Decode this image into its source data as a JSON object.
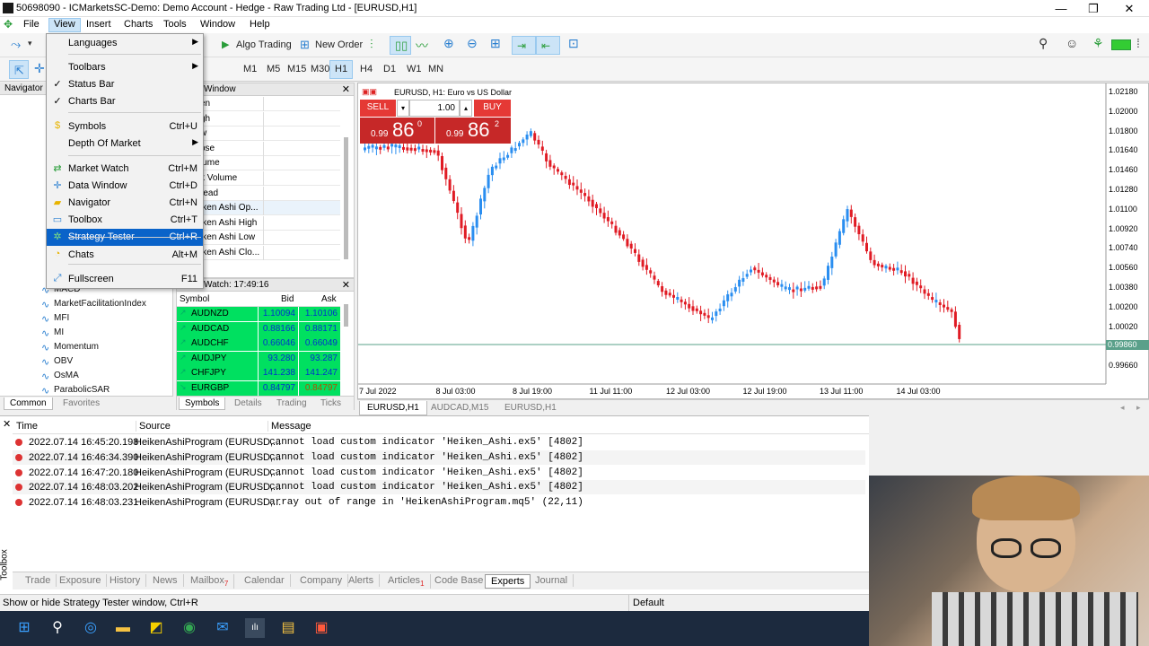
{
  "window": {
    "title": "50698090 - ICMarketsSC-Demo: Demo Account - Hedge - Raw Trading Ltd - [EURUSD,H1]",
    "min": "—",
    "max": "❐",
    "close": "✕"
  },
  "menubar": [
    "File",
    "View",
    "Insert",
    "Charts",
    "Tools",
    "Window",
    "Help"
  ],
  "toolbar": {
    "algo_trading": "Algo Trading",
    "new_order": "New Order"
  },
  "timeframes": [
    "M1",
    "M5",
    "M15",
    "M30",
    "H1",
    "H4",
    "D1",
    "W1",
    "MN"
  ],
  "view_menu": [
    {
      "label": "Languages",
      "shortcut": "",
      "submenu": true
    },
    {
      "label": "Toolbars",
      "shortcut": "",
      "submenu": true
    },
    {
      "label": "Status Bar",
      "shortcut": "",
      "check": true
    },
    {
      "label": "Charts Bar",
      "shortcut": "",
      "check": true
    },
    {
      "label": "Symbols",
      "shortcut": "Ctrl+U"
    },
    {
      "label": "Depth Of Market",
      "shortcut": "",
      "submenu": true
    },
    {
      "label": "Market Watch",
      "shortcut": "Ctrl+M"
    },
    {
      "label": "Data Window",
      "shortcut": "Ctrl+D"
    },
    {
      "label": "Navigator",
      "shortcut": "Ctrl+N"
    },
    {
      "label": "Toolbox",
      "shortcut": "Ctrl+T"
    },
    {
      "label": "Strategy Tester",
      "shortcut": "Ctrl+R"
    },
    {
      "label": "Chats",
      "shortcut": "Alt+M"
    },
    {
      "label": "Fullscreen",
      "shortcut": "F11"
    }
  ],
  "navigator": {
    "title": "Navigator",
    "items": [
      "MACD",
      "MarketFacilitationIndex",
      "MFI",
      "MI",
      "Momentum",
      "OBV",
      "OsMA",
      "ParabolicSAR"
    ],
    "tabs": [
      "Common",
      "Favorites"
    ]
  },
  "data_window": {
    "title": "Window",
    "rows": [
      "en",
      "gh",
      "w",
      "ose",
      "lume",
      "k Volume",
      "read",
      "iken Ashi Op...",
      "iken Ashi High",
      "iken Ashi Low",
      "iken Ashi Clo..."
    ]
  },
  "market_watch": {
    "title": "Watch: 17:49:16",
    "headers": [
      "Symbol",
      "Bid",
      "Ask"
    ],
    "rows": [
      {
        "symbol": "AUDNZD",
        "bid": "1.10094",
        "ask": "1.10106",
        "dir": "up"
      },
      {
        "symbol": "AUDCAD",
        "bid": "0.88166",
        "ask": "0.88171",
        "dir": "up"
      },
      {
        "symbol": "AUDCHF",
        "bid": "0.66046",
        "ask": "0.66049",
        "dir": "up"
      },
      {
        "symbol": "AUDJPY",
        "bid": "93.280",
        "ask": "93.287",
        "dir": "up"
      },
      {
        "symbol": "CHFJPY",
        "bid": "141.238",
        "ask": "141.247",
        "dir": "up"
      },
      {
        "symbol": "EURGBP",
        "bid": "0.84797",
        "ask": "0.84797",
        "dir": "down"
      }
    ],
    "tabs": [
      "Symbols",
      "Details",
      "Trading",
      "Ticks"
    ]
  },
  "chart": {
    "header": "EURUSD, H1:  Euro vs US Dollar",
    "sell_label": "SELL",
    "buy_label": "BUY",
    "lot": "1.00",
    "sell_price_small": "0.99",
    "sell_price_big": "86",
    "sell_price_sup": "0",
    "buy_price_small": "0.99",
    "buy_price_big": "86",
    "buy_price_sup": "2",
    "price_axis": [
      "1.02180",
      "1.02000",
      "1.01800",
      "1.01640",
      "1.01460",
      "1.01280",
      "1.01100",
      "1.00920",
      "1.00740",
      "1.00560",
      "1.00380",
      "1.00200",
      "1.00020",
      "0.99860",
      "0.99660"
    ],
    "current_price_label": "0.99860",
    "time_axis": [
      "7 Jul 2022",
      "8 Jul 03:00",
      "8 Jul 19:00",
      "11 Jul 11:00",
      "12 Jul 03:00",
      "12 Jul 19:00",
      "13 Jul 11:00",
      "14 Jul 03:00"
    ],
    "tabs": [
      "EURUSD,H1",
      "AUDCAD,M15",
      "EURUSD,H1"
    ],
    "colors": {
      "bull": "#2a8ef0",
      "bear": "#e01b24",
      "price_line": "#5aa08a"
    }
  },
  "toolbox": {
    "headers": [
      "Time",
      "Source",
      "Message"
    ],
    "rows": [
      {
        "time": "2022.07.14 16:45:20.198",
        "source": "HeikenAshiProgram (EURUSD,...",
        "message": "cannot load custom indicator 'Heiken_Ashi.ex5' [4802]"
      },
      {
        "time": "2022.07.14 16:46:34.390",
        "source": "HeikenAshiProgram (EURUSD,...",
        "message": "cannot load custom indicator 'Heiken_Ashi.ex5' [4802]"
      },
      {
        "time": "2022.07.14 16:47:20.180",
        "source": "HeikenAshiProgram (EURUSD,...",
        "message": "cannot load custom indicator 'Heiken_Ashi.ex5' [4802]"
      },
      {
        "time": "2022.07.14 16:48:03.202",
        "source": "HeikenAshiProgram (EURUSD,...",
        "message": "cannot load custom indicator 'Heiken_Ashi.ex5' [4802]"
      },
      {
        "time": "2022.07.14 16:48:03.231",
        "source": "HeikenAshiProgram (EURUSD,...",
        "message": "array out of range in 'HeikenAshiProgram.mq5' (22,11)"
      }
    ],
    "side_label": "Toolbox",
    "tabs": [
      {
        "label": "Trade",
        "badge": ""
      },
      {
        "label": "Exposure",
        "badge": ""
      },
      {
        "label": "History",
        "badge": ""
      },
      {
        "label": "News",
        "badge": ""
      },
      {
        "label": "Mailbox",
        "badge": "7"
      },
      {
        "label": "Calendar",
        "badge": ""
      },
      {
        "label": "Company",
        "badge": ""
      },
      {
        "label": "Alerts",
        "badge": ""
      },
      {
        "label": "Articles",
        "badge": "1"
      },
      {
        "label": "Code Base",
        "badge": ""
      },
      {
        "label": "Experts",
        "badge": ""
      },
      {
        "label": "Journal",
        "badge": ""
      }
    ]
  },
  "statusbar": {
    "hint": "Show or hide Strategy Tester window, Ctrl+R",
    "profile": "Default"
  }
}
